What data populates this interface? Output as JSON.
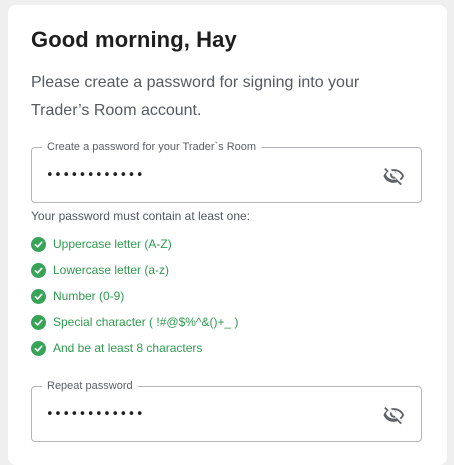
{
  "greeting": "Good morning, Hay",
  "intro": "Please create a password for signing into your Trader’s Room account.",
  "password_field": {
    "label": "Create a password for your Trader`s Room",
    "value": "••••••••••••"
  },
  "requirements": {
    "title": "Your password must contain at least one:",
    "items": [
      "Uppercase letter (A-Z)",
      "Lowercase letter (a-z)",
      "Number (0-9)",
      "Special character ( !#@$%^&()+_ )",
      "And be at least 8 characters"
    ]
  },
  "repeat_field": {
    "label": "Repeat password",
    "value": "••••••••••••"
  },
  "icons": {
    "visibility_toggle": "eye-off-icon",
    "requirement_status": "check-circle-icon"
  },
  "colors": {
    "success": "#37a357",
    "icon": "#5f6368"
  }
}
